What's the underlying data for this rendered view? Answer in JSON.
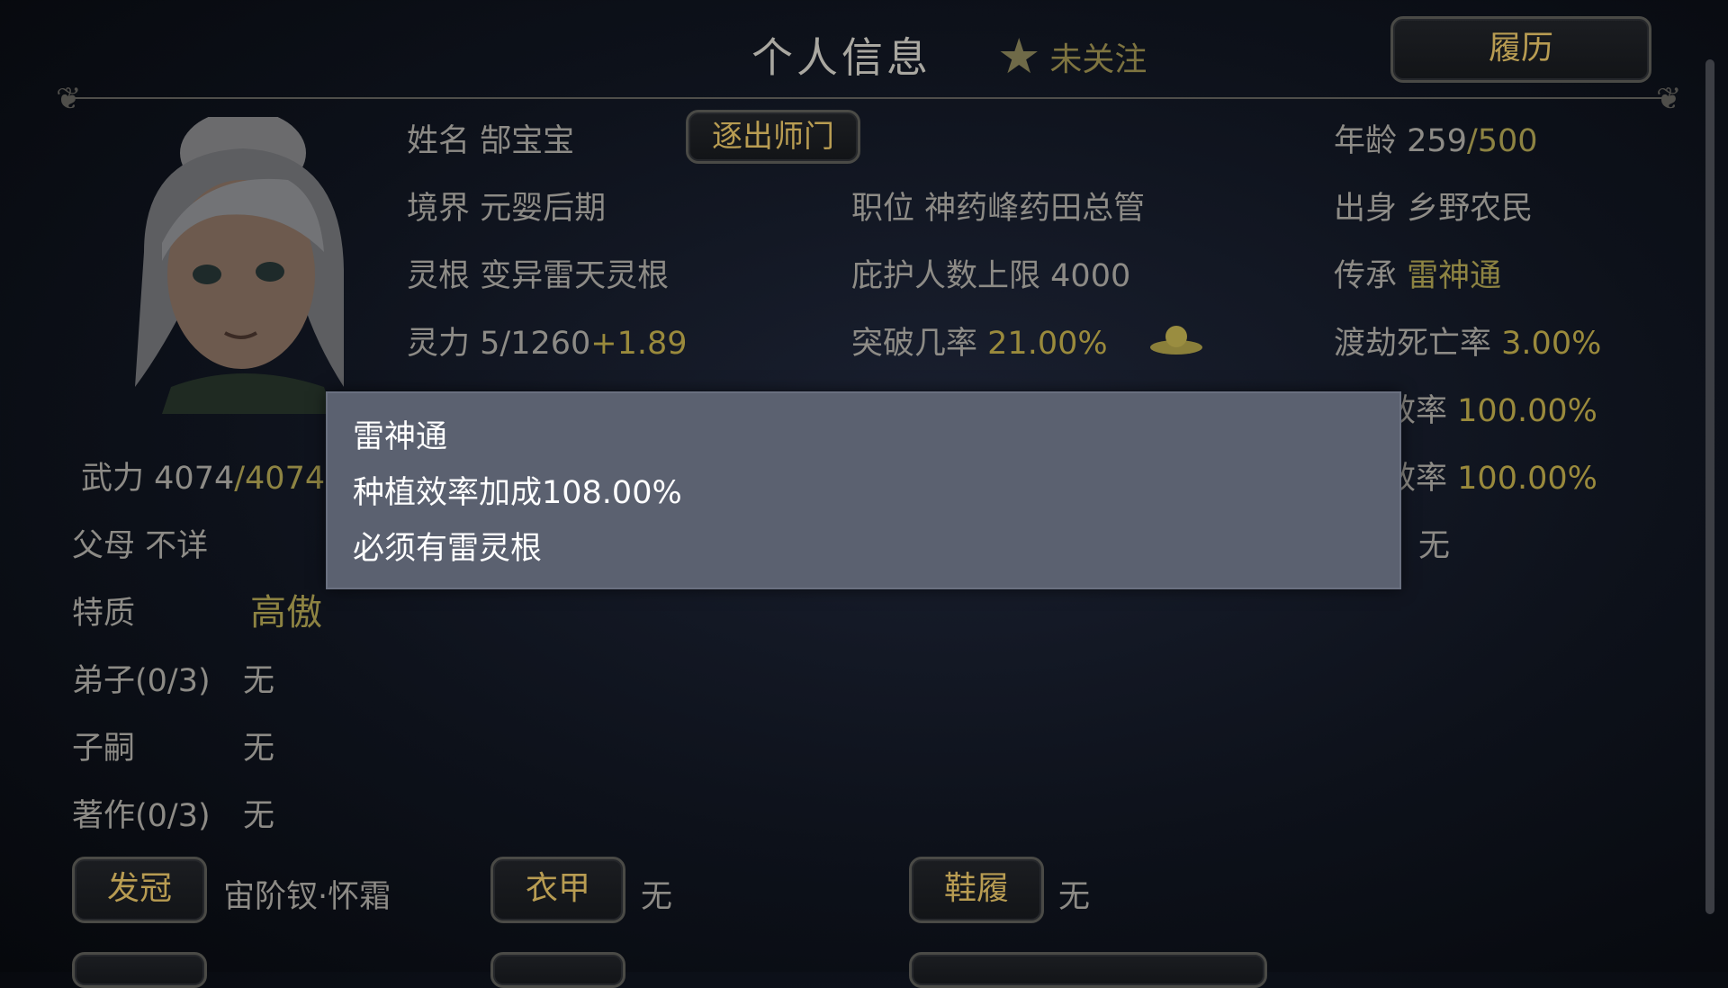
{
  "header": {
    "title": "个人信息",
    "follow_label": "未关注",
    "history_button": "履历"
  },
  "profile": {
    "name_label": "姓名",
    "name_value": "郜宝宝",
    "expel_button": "逐出师门",
    "age_label": "年龄",
    "age_current": "259",
    "age_max": "/500",
    "realm_label": "境界",
    "realm_value": "元婴后期",
    "position_label": "职位",
    "position_value": "神药峰药田总管",
    "origin_label": "出身",
    "origin_value": "乡野农民",
    "root_label": "灵根",
    "root_value": "变异雷天灵根",
    "protect_label": "庇护人数上限",
    "protect_value": "4000",
    "inherit_label": "传承",
    "inherit_value": "雷神通",
    "spirit_label": "灵力",
    "spirit_value": "5/1260",
    "spirit_bonus": "+1.89",
    "breakthrough_label": "突破几率",
    "breakthrough_value": "21.00%",
    "tribulation_label": "渡劫死亡率",
    "tribulation_value": "3.00%",
    "eff1_label": "效率",
    "eff1_value": "100.00%",
    "eff2_label": "效率",
    "eff2_value": "100.00%",
    "right_none": "无",
    "force_label": "武力",
    "force_current": "4074",
    "force_max": "/4074",
    "parents_label": "父母",
    "parents_value": "不详",
    "trait_label": "特质",
    "trait_value": "高傲",
    "disciples_label": "弟子(0/3)",
    "disciples_value": "无",
    "heirs_label": "子嗣",
    "heirs_value": "无",
    "works_label": "著作(0/3)",
    "works_value": "无"
  },
  "equipment": {
    "crown_button": "发冠",
    "crown_value": "宙阶钗·怀霜",
    "armor_button": "衣甲",
    "armor_value": "无",
    "shoes_button": "鞋履",
    "shoes_value": "无"
  },
  "tooltip": {
    "title": "雷神通",
    "line1": "种植效率加成108.00%",
    "line2": "必须有雷灵根"
  }
}
